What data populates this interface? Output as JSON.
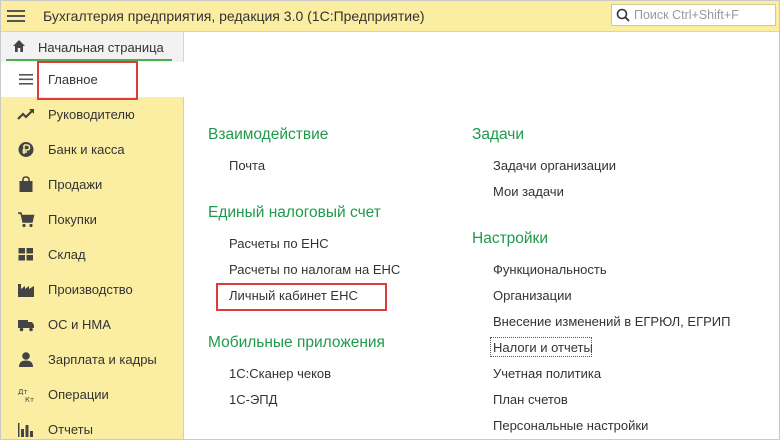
{
  "window": {
    "title": "Бухгалтерия предприятия, редакция 3.0  (1С:Предприятие)",
    "search_placeholder": "Поиск Ctrl+Shift+F"
  },
  "tabs": {
    "home_label": "Начальная страница"
  },
  "sidebar": {
    "items": [
      {
        "label": "Главное",
        "icon": "menu-lines-icon"
      },
      {
        "label": "Руководителю",
        "icon": "trend-chart-icon"
      },
      {
        "label": "Банк и касса",
        "icon": "ruble-coin-icon"
      },
      {
        "label": "Продажи",
        "icon": "shopping-bag-icon"
      },
      {
        "label": "Покупки",
        "icon": "shopping-cart-icon"
      },
      {
        "label": "Склад",
        "icon": "warehouse-grid-icon"
      },
      {
        "label": "Производство",
        "icon": "factory-icon"
      },
      {
        "label": "ОС и НМА",
        "icon": "truck-icon"
      },
      {
        "label": "Зарплата и кадры",
        "icon": "person-icon"
      },
      {
        "label": "Операции",
        "icon": "debit-credit-icon"
      },
      {
        "label": "Отчеты",
        "icon": "bar-chart-icon"
      }
    ]
  },
  "main": {
    "left_groups": [
      {
        "title": "Взаимодействие",
        "items": [
          "Почта"
        ]
      },
      {
        "title": "Единый налоговый счет",
        "items": [
          "Расчеты по ЕНС",
          "Расчеты по налогам на ЕНС",
          "Личный кабинет ЕНС"
        ]
      },
      {
        "title": "Мобильные приложения",
        "items": [
          "1С:Сканер чеков",
          "1С-ЭПД"
        ]
      }
    ],
    "right_groups": [
      {
        "title": "Задачи",
        "items": [
          "Задачи организации",
          "Мои задачи"
        ]
      },
      {
        "title": "Настройки",
        "items": [
          "Функциональность",
          "Организации",
          "Внесение изменений в ЕГРЮЛ, ЕГРИП",
          "Налоги и отчеты",
          "Учетная политика",
          "План счетов",
          "Персональные настройки"
        ]
      }
    ]
  },
  "colors": {
    "panel_yellow": "#fbeea3",
    "group_title_green": "#1f9a4b",
    "highlight_red": "#e03b3b",
    "tab_underline_green": "#4caf50"
  }
}
